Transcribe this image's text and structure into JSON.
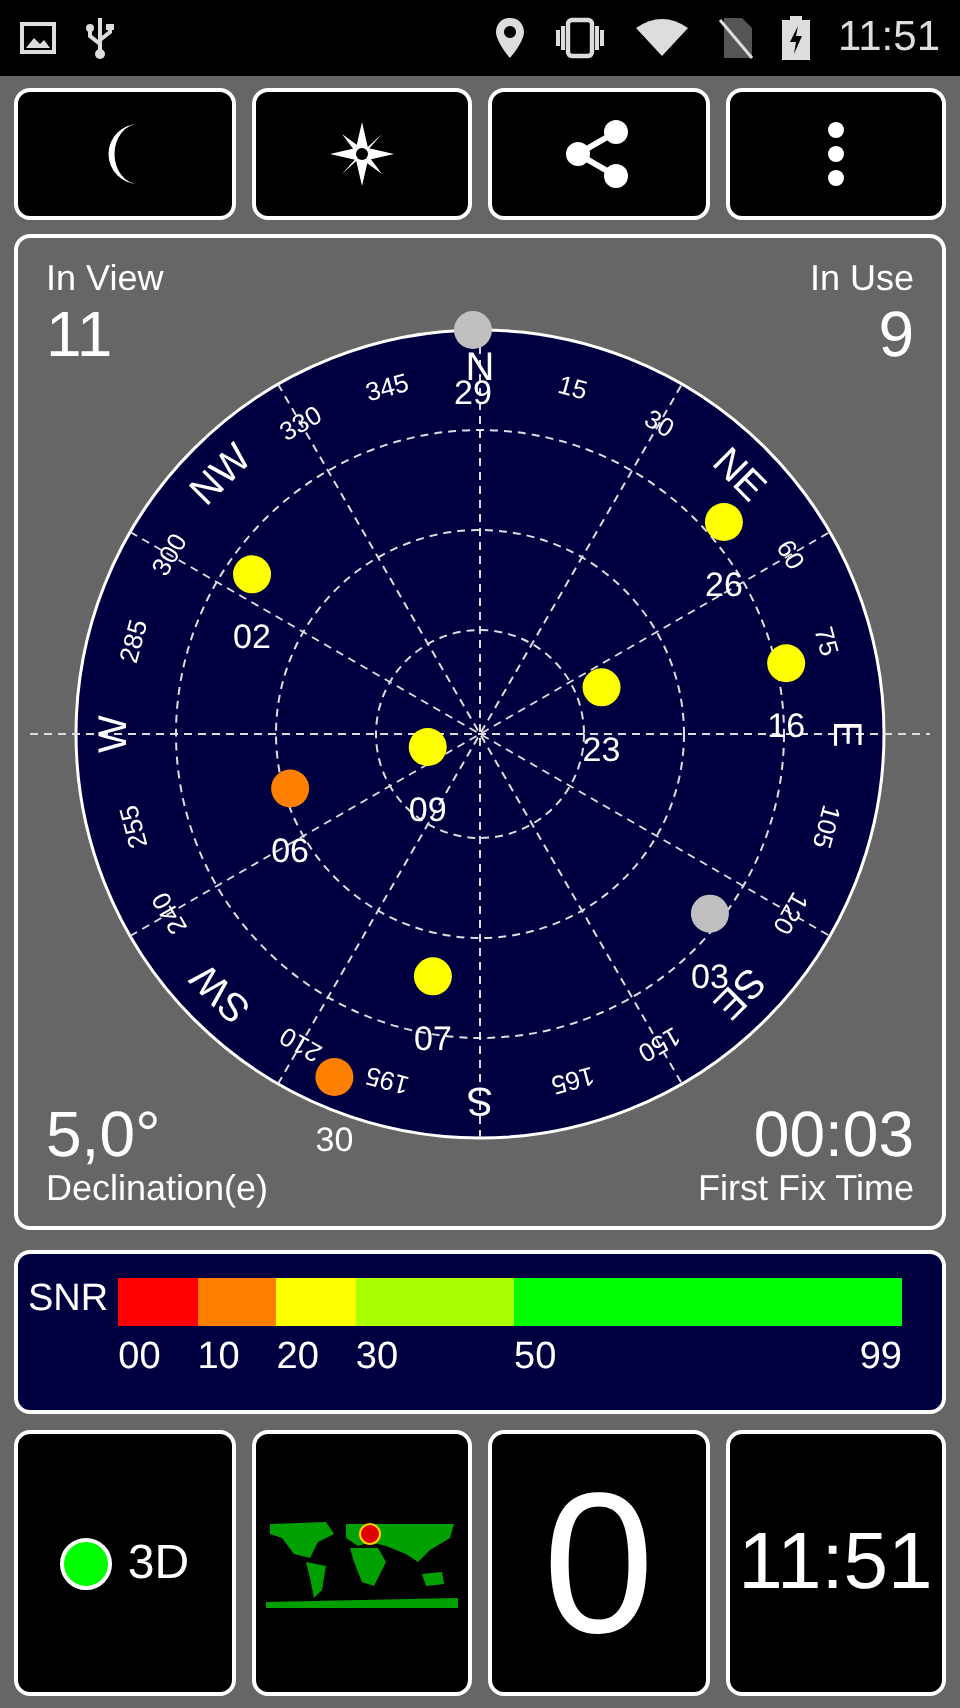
{
  "status_bar": {
    "time": "11:51"
  },
  "toolbar": [
    {
      "kind": "night"
    },
    {
      "kind": "compass"
    },
    {
      "kind": "share"
    },
    {
      "kind": "more"
    }
  ],
  "sky": {
    "in_view_label": "In View",
    "in_view": "11",
    "in_use_label": "In Use",
    "in_use": "9",
    "declination": "5,0°",
    "declination_label": "Declination(e)",
    "fix_time": "00:03",
    "fix_time_label": "First Fix Time",
    "marks": [
      {
        "label": "N",
        "kind": "cardinal"
      },
      {
        "label": "15",
        "kind": "degree"
      },
      {
        "label": "30",
        "kind": "degree"
      },
      {
        "label": "NE",
        "kind": "cardinal"
      },
      {
        "label": "60",
        "kind": "degree"
      },
      {
        "label": "75",
        "kind": "degree"
      },
      {
        "label": "E",
        "kind": "cardinal"
      },
      {
        "label": "105",
        "kind": "degree"
      },
      {
        "label": "120",
        "kind": "degree"
      },
      {
        "label": "SE",
        "kind": "cardinal"
      },
      {
        "label": "150",
        "kind": "degree"
      },
      {
        "label": "165",
        "kind": "degree"
      },
      {
        "label": "S",
        "kind": "cardinal"
      },
      {
        "label": "195",
        "kind": "degree"
      },
      {
        "label": "210",
        "kind": "degree"
      },
      {
        "label": "SW",
        "kind": "cardinal"
      },
      {
        "label": "240",
        "kind": "degree"
      },
      {
        "label": "255",
        "kind": "degree"
      },
      {
        "label": "W",
        "kind": "cardinal"
      },
      {
        "label": "285",
        "kind": "degree"
      },
      {
        "label": "300",
        "kind": "degree"
      },
      {
        "label": "NW",
        "kind": "cardinal"
      },
      {
        "label": "330",
        "kind": "degree"
      },
      {
        "label": "345",
        "kind": "degree"
      }
    ],
    "satellites": [
      {
        "id": "29",
        "color": "#c0c0c0"
      },
      {
        "id": "26",
        "color": "#ffff00"
      },
      {
        "id": "02",
        "color": "#ffff00"
      },
      {
        "id": "16",
        "color": "#ffff00"
      },
      {
        "id": "23",
        "color": "#ffff00"
      },
      {
        "id": "09",
        "color": "#ffff00"
      },
      {
        "id": "06",
        "color": "#ff8000"
      },
      {
        "id": "07",
        "color": "#ffff00"
      },
      {
        "id": "03",
        "color": "#c0c0c0"
      },
      {
        "id": "30",
        "color": "#ff8000"
      }
    ]
  },
  "snr": {
    "label": "SNR",
    "segments": [
      {
        "label": "00",
        "color": "#ff0000"
      },
      {
        "label": "10",
        "color": "#ff8000"
      },
      {
        "label": "20",
        "color": "#ffff00"
      },
      {
        "label": "30",
        "color": "#aaff00"
      },
      {
        "label": "50",
        "color": "#00ff00"
      }
    ],
    "end_label": "99"
  },
  "tiles": {
    "fix": {
      "label": "3D",
      "fixed": true
    },
    "satellite_count": "0",
    "clock": "11:51"
  }
}
